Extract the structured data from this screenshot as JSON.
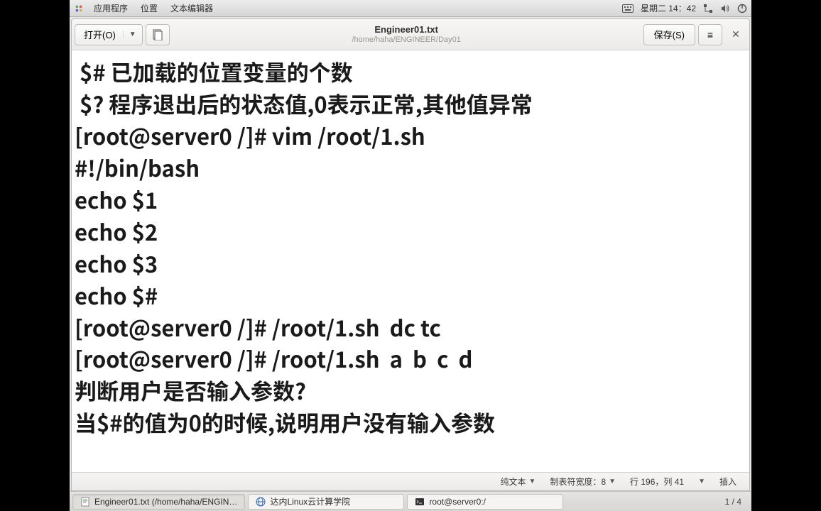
{
  "panel": {
    "apps": "应用程序",
    "places": "位置",
    "text_editor": "文本编辑器",
    "clock": "星期二 14：42"
  },
  "window": {
    "open_label": "打开(O)",
    "title": "Engineer01.txt",
    "subtitle": "/home/haha/ENGINEER/Day01",
    "save_label": "保存(S)"
  },
  "editor": {
    "lines": [
      " $# 已加载的位置变量的个数",
      " $? 程序退出后的状态值,0表示正常,其他值异常",
      "[root@server0 /]# vim /root/1.sh",
      "#!/bin/bash",
      "echo $1",
      "echo $2",
      "echo $3",
      "echo $#",
      "[root@server0 /]# /root/1.sh  dc tc",
      "[root@server0 /]# /root/1.sh  a  b  c  d",
      "判断用户是否输入参数?",
      "当$#的值为0的时候,说明用户没有输入参数"
    ]
  },
  "statusbar": {
    "syntax": "纯文本",
    "tab_width": "制表符宽度：8",
    "position": "行 196，列 41",
    "mode": "插入"
  },
  "taskbar": {
    "items": [
      "Engineer01.txt (/home/haha/ENGIN…",
      "达内Linux云计算学院",
      "root@server0:/"
    ],
    "pager": "1 / 4"
  }
}
